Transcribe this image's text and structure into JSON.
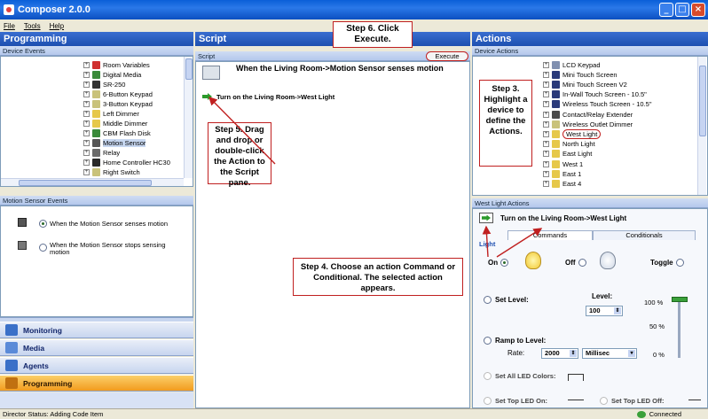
{
  "window": {
    "title": "Composer 2.0.0"
  },
  "menu": [
    "File",
    "Tools",
    "Help"
  ],
  "programming": {
    "header": "Programming",
    "device_events_label": "Device Events",
    "tree": [
      {
        "label": "Room Variables",
        "color": "#d03030"
      },
      {
        "label": "Digital Media",
        "color": "#3a8a3a"
      },
      {
        "label": "SR-250",
        "color": "#333333"
      },
      {
        "label": "6-Button Keypad",
        "color": "#c9c27a"
      },
      {
        "label": "3-Button Keypad",
        "color": "#c9c27a"
      },
      {
        "label": "Left Dimmer",
        "color": "#e6c84a"
      },
      {
        "label": "Middle Dimmer",
        "color": "#e6c84a"
      },
      {
        "label": "CBM Flash Disk",
        "color": "#3a8a3a"
      },
      {
        "label": "Motion Sensor",
        "color": "#555555"
      },
      {
        "label": "Relay",
        "color": "#6a6a6a"
      },
      {
        "label": "Home Controller HC30",
        "color": "#2a2a2a"
      },
      {
        "label": "Right Switch",
        "color": "#c9c27a"
      }
    ],
    "motion_events_label": "Motion Sensor Events",
    "motion_events": [
      "When the Motion Sensor senses motion",
      "When the Motion Sensor stops sensing motion"
    ],
    "nav": [
      {
        "label": "Monitoring",
        "color": "#3a70c8"
      },
      {
        "label": "Media",
        "color": "#5a8ad8"
      },
      {
        "label": "Agents",
        "color": "#3a70c8"
      },
      {
        "label": "Programming",
        "color": "#c07010"
      }
    ]
  },
  "script": {
    "header": "Script",
    "sub": "Script",
    "execute": "Execute",
    "event_title": "When the Living Room->Motion Sensor senses motion",
    "action_line": "Turn on the Living Room->West Light"
  },
  "actions": {
    "header": "Actions",
    "device_actions_label": "Device Actions",
    "tree": [
      {
        "label": "LCD Keypad",
        "color": "#8090b0"
      },
      {
        "label": "Mini Touch Screen",
        "color": "#2a3a7a"
      },
      {
        "label": "Mini Touch Screen V2",
        "color": "#2a3a7a"
      },
      {
        "label": "In-Wall Touch Screen - 10.5\"",
        "color": "#2a3a7a"
      },
      {
        "label": "Wireless Touch Screen - 10.5\"",
        "color": "#2a3a7a"
      },
      {
        "label": "Contact/Relay Extender",
        "color": "#4a4a4a"
      },
      {
        "label": "Wireless Outlet Dimmer",
        "color": "#c9c27a"
      },
      {
        "label": "West Light",
        "color": "#e6c84a"
      },
      {
        "label": "North Light",
        "color": "#e6c84a"
      },
      {
        "label": "East Light",
        "color": "#e6c84a"
      },
      {
        "label": "West 1",
        "color": "#e6c84a"
      },
      {
        "label": "East 1",
        "color": "#e6c84a"
      },
      {
        "label": "East 4",
        "color": "#e6c84a"
      }
    ],
    "west_actions_label": "West Light Actions",
    "selected_action": "Turn on the Living Room->West Light",
    "tabs": [
      "Commands",
      "Conditionals"
    ],
    "light_label": "Light",
    "on_label": "On",
    "off_label": "Off",
    "toggle_label": "Toggle",
    "set_level": "Set Level:",
    "level_label": "Level:",
    "level_value": "100",
    "pct_100": "100 %",
    "pct_50": "50 %",
    "pct_0": "0 %",
    "ramp_label": "Ramp to Level:",
    "rate_label": "Rate:",
    "rate_value": "2000",
    "unit_value": "Millisec",
    "led_colors": "Set All LED Colors:",
    "top_led_on": "Set Top LED On:",
    "top_led_off": "Set Top LED Off:"
  },
  "callouts": {
    "step6": "Step 6. Click Execute.",
    "step3": "Step 3. Highlight a device to define the Actions.",
    "step5": "Step 5. Drag and drop or double-click the Action to the Script pane.",
    "step4": "Step 4. Choose an action Command or Conditional. The selected action appears."
  },
  "status": {
    "left": "Director Status: Adding Code Item",
    "right": "Connected"
  },
  "colors": {
    "accent_red": "#c02020",
    "header_blue": "#1d4fb0",
    "nav_active": "#f29b1e"
  }
}
